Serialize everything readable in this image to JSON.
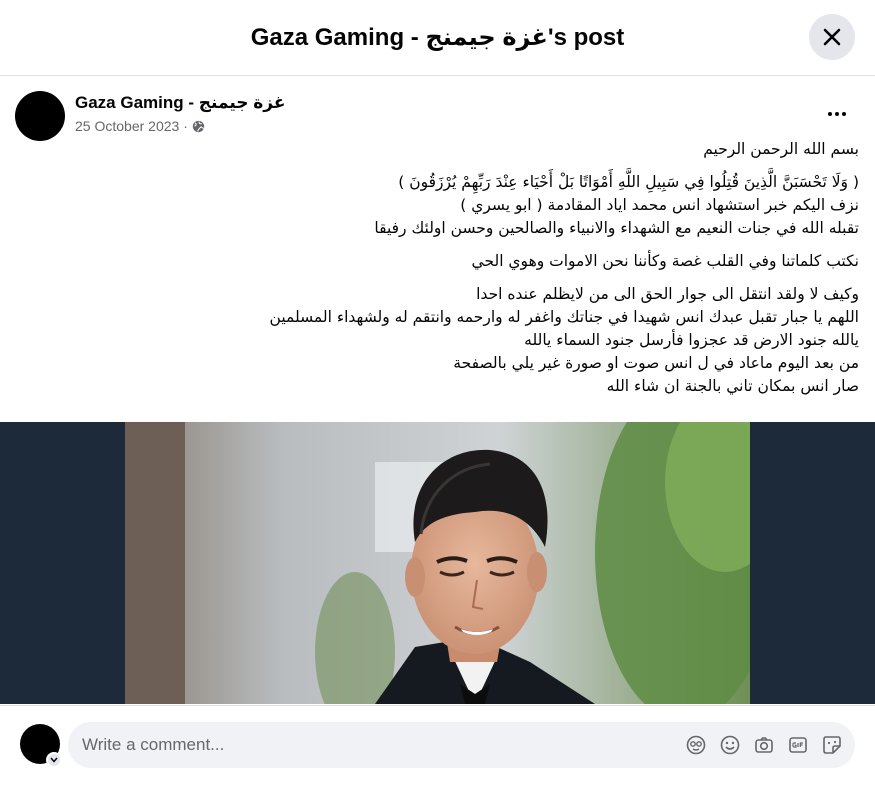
{
  "header": {
    "title": "Gaza Gaming - غزة جيمنج's post"
  },
  "post": {
    "page_name": "Gaza Gaming - غزة جيمنج",
    "date": "25 October 2023",
    "separator": "·",
    "audience_icon": "globe-icon",
    "more_icon": "more-horizontal-icon",
    "paragraphs": [
      [
        "بسم الله الرحمن الرحيم"
      ],
      [
        "( وَلَا تَحْسَبَنَّ الَّذِينَ قُتِلُوا فِي سَبِيلِ اللَّهِ أَمْوَاتًا بَلْ أَحْيَاء عِنْدَ رَبِّهِمْ يُرْزَقُونَ )",
        "نزف اليكم خبر استشهاد انس محمد اياد المقادمة ( ابو يسري )",
        "تقبله الله في جنات النعيم مع الشهداء والانبياء والصالحين وحسن اولئك رفيقا"
      ],
      [
        "نكتب كلماتنا وفي القلب غصة وكأننا نحن الاموات وهوي الحي"
      ],
      [
        "وكيف لا ولقد انتقل الى جوار الحق الى من لايظلم عنده احدا",
        "اللهم يا جبار تقبل عبدك انس شهيدا في جناتك واغفر له وارحمه وانتقم له ولشهداء المسلمين",
        "يالله جنود الارض قد عجزوا فأرسل جنود السماء يالله",
        "من بعد اليوم ماعاد في ل انس صوت او صورة غير يلي بالصفحة",
        "صار انس بمكان تاني بالجنة ان شاء الله"
      ]
    ]
  },
  "comment": {
    "placeholder": "Write a comment...",
    "icons": [
      "avatar-sticker-icon",
      "emoji-icon",
      "camera-icon",
      "gif-icon",
      "sticker-icon"
    ]
  },
  "colors": {
    "primary_text": "#050505",
    "secondary_text": "#65676b",
    "button_bg": "#e4e6eb",
    "input_bg": "#f0f2f5",
    "media_bg": "#1c2a39"
  }
}
